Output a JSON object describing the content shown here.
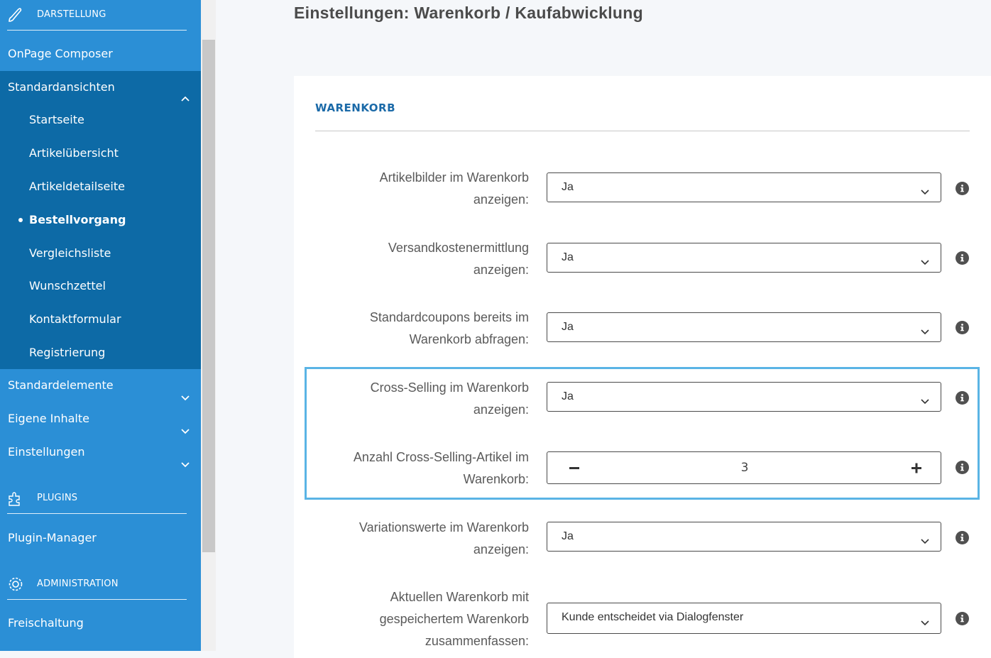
{
  "sidebar": {
    "section_darstellung": "DARSTELLUNG",
    "onpage_composer": "OnPage Composer",
    "standardansichten": "Standardansichten",
    "sub_items": [
      "Startseite",
      "Artikelübersicht",
      "Artikeldetailseite",
      "Bestellvorgang",
      "Vergleichsliste",
      "Wunschzettel",
      "Kontaktformular",
      "Registrierung"
    ],
    "active_sub_item": "Bestellvorgang",
    "standardelemente": "Standardelemente",
    "eigene_inhalte": "Eigene Inhalte",
    "einstellungen": "Einstellungen",
    "section_plugins": "PLUGINS",
    "plugin_manager": "Plugin-Manager",
    "section_administration": "ADMINISTRATION",
    "freischaltung": "Freischaltung"
  },
  "page": {
    "title": "Einstellungen: Warenkorb / Kaufabwicklung",
    "card_heading": "WARENKORB"
  },
  "settings": [
    {
      "label_line1": "Artikelbilder im Warenkorb",
      "label_line2": "anzeigen:",
      "value": "Ja"
    },
    {
      "label_line1": "Versandkostenermittlung",
      "label_line2": "anzeigen:",
      "value": "Ja"
    },
    {
      "label_line1": "Standardcoupons bereits im",
      "label_line2": "Warenkorb abfragen:",
      "value": "Ja"
    },
    {
      "label_line1": "Cross-Selling im Warenkorb",
      "label_line2": "anzeigen:",
      "value": "Ja"
    },
    {
      "label_line1": "Anzahl Cross-Selling-Artikel im",
      "label_line2": "Warenkorb:",
      "value": "3"
    },
    {
      "label_line1": "Variationswerte im Warenkorb",
      "label_line2": "anzeigen:",
      "value": "Ja"
    },
    {
      "label_line1": "Aktuellen Warenkorb mit",
      "label_line2": "gespeichertem Warenkorb",
      "label_line3": "zusammenfassen:",
      "value": "Kunde entscheidet via Dialogfenster"
    }
  ],
  "colors": {
    "sidebar_bg": "#2b8fd6",
    "sidebar_active_bg": "#0d6aa6",
    "heading_blue": "#1b6aa8",
    "highlight_border": "#5ab4e5"
  },
  "icons": [
    "brush-icon",
    "puzzle-icon",
    "gear-icon",
    "chevron-up-icon",
    "chevron-down-icon",
    "info-icon",
    "minus-icon",
    "plus-icon"
  ]
}
